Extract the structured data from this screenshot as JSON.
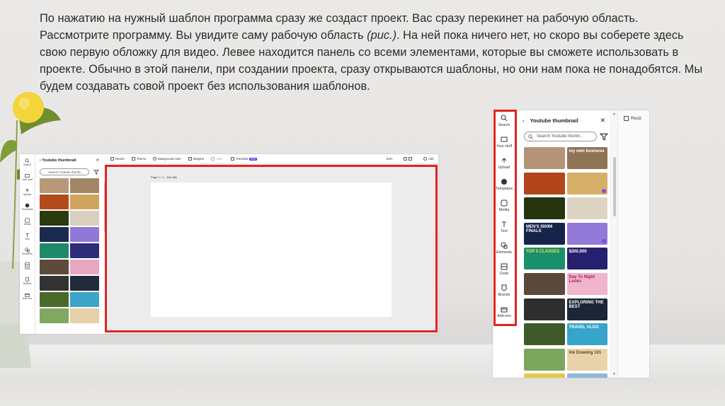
{
  "paragraph": {
    "part1": "По нажатию на нужный шаблон программа сразу же создаст проект. Вас сразу перекинет на рабочую область. Рассмотрите программу. Вы увидите саму рабочую область ",
    "figure_ref": "(рис.)",
    "part2": ". На ней пока ничего нет, но скоро вы соберете здесь свою первую обложку для видео. Левее находится панель со всеми элементами, которые вы сможете использовать в проекте. Обычно в этой панели, при создании проекта, сразу открываются шаблоны, но они нам пока не понадобятся. Мы будем создавать совой проект без использования шаблонов."
  },
  "editor": {
    "rail": [
      "Search",
      "Your stuff",
      "Upload",
      "Templates",
      "Media",
      "Text",
      "Elements",
      "Grids",
      "Brands",
      "Add-ons"
    ],
    "panel_title": "Youtube thumbnail",
    "search_placeholder": "Search Youtube thumb...",
    "toolbar": {
      "resize": "Resize",
      "theme": "Theme",
      "background_color": "Background color",
      "margins": "Margins",
      "align": "Align",
      "translate": "Translate",
      "new_badge": "NEW",
      "zoom": "84%",
      "add": "Add"
    },
    "page_label": "Page 1 / 1 – Add title"
  },
  "sidebar": {
    "rail": [
      "Search",
      "Your stuff",
      "Upload",
      "Templates",
      "Media",
      "Text",
      "Elements",
      "Grids",
      "Brands",
      "Add-ons"
    ],
    "panel_title": "Youtube thumbnail",
    "search_placeholder": "Search Youtube thumb...",
    "resize": "Resiz",
    "thumbnails": [
      [
        "",
        "my own business"
      ],
      [
        "",
        ""
      ],
      [
        "",
        ""
      ],
      [
        "MEN'S I500M FINALS",
        ""
      ],
      [
        "TOP 5 CLASSES",
        "$200,000"
      ],
      [
        "",
        "Day To Night Looks"
      ],
      [
        "",
        "EXPLORING THE BEST"
      ],
      [
        "",
        "TRAVEL VLOG"
      ],
      [
        "",
        "Ink Drawing 101"
      ],
      [
        "",
        ""
      ]
    ]
  }
}
